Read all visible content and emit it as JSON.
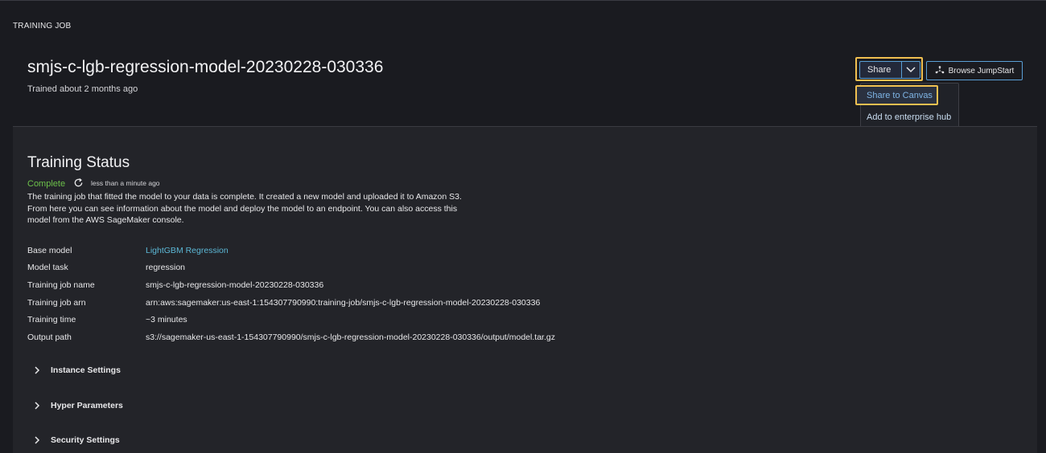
{
  "header": {
    "section_label": "TRAINING JOB",
    "title": "smjs-c-lgb-regression-model-20230228-030336",
    "subtitle": "Trained about 2 months ago"
  },
  "actions": {
    "share_label": "Share",
    "browse_label": "Browse JumpStart",
    "menu": [
      "Share to Canvas",
      "Add to enterprise hub"
    ]
  },
  "status": {
    "heading": "Training Status",
    "state": "Complete",
    "updated": "less than a minute ago",
    "description": "The training job that fitted the model to your data is complete. It created a new model and uploaded it to Amazon S3. From here you can see information about the model and deploy the model to an endpoint. You can also access this model from the AWS SageMaker console."
  },
  "details": [
    {
      "key": "Base model",
      "value": "LightGBM Regression"
    },
    {
      "key": "Model task",
      "value": "regression"
    },
    {
      "key": "Training job name",
      "value": "smjs-c-lgb-regression-model-20230228-030336"
    },
    {
      "key": "Training job arn",
      "value": "arn:aws:sagemaker:us-east-1:154307790990:training-job/smjs-c-lgb-regression-model-20230228-030336"
    },
    {
      "key": "Training time",
      "value": "~3 minutes"
    },
    {
      "key": "Output path",
      "value": "s3://sagemaker-us-east-1-154307790990/smjs-c-lgb-regression-model-20230228-030336/output/model.tar.gz"
    }
  ],
  "sections": [
    "Instance Settings",
    "Hyper Parameters",
    "Security Settings"
  ],
  "colors": {
    "accent": "#5a9fd6",
    "focus": "#f0c050",
    "success": "#6cc04a",
    "link": "#5cb8d6"
  }
}
